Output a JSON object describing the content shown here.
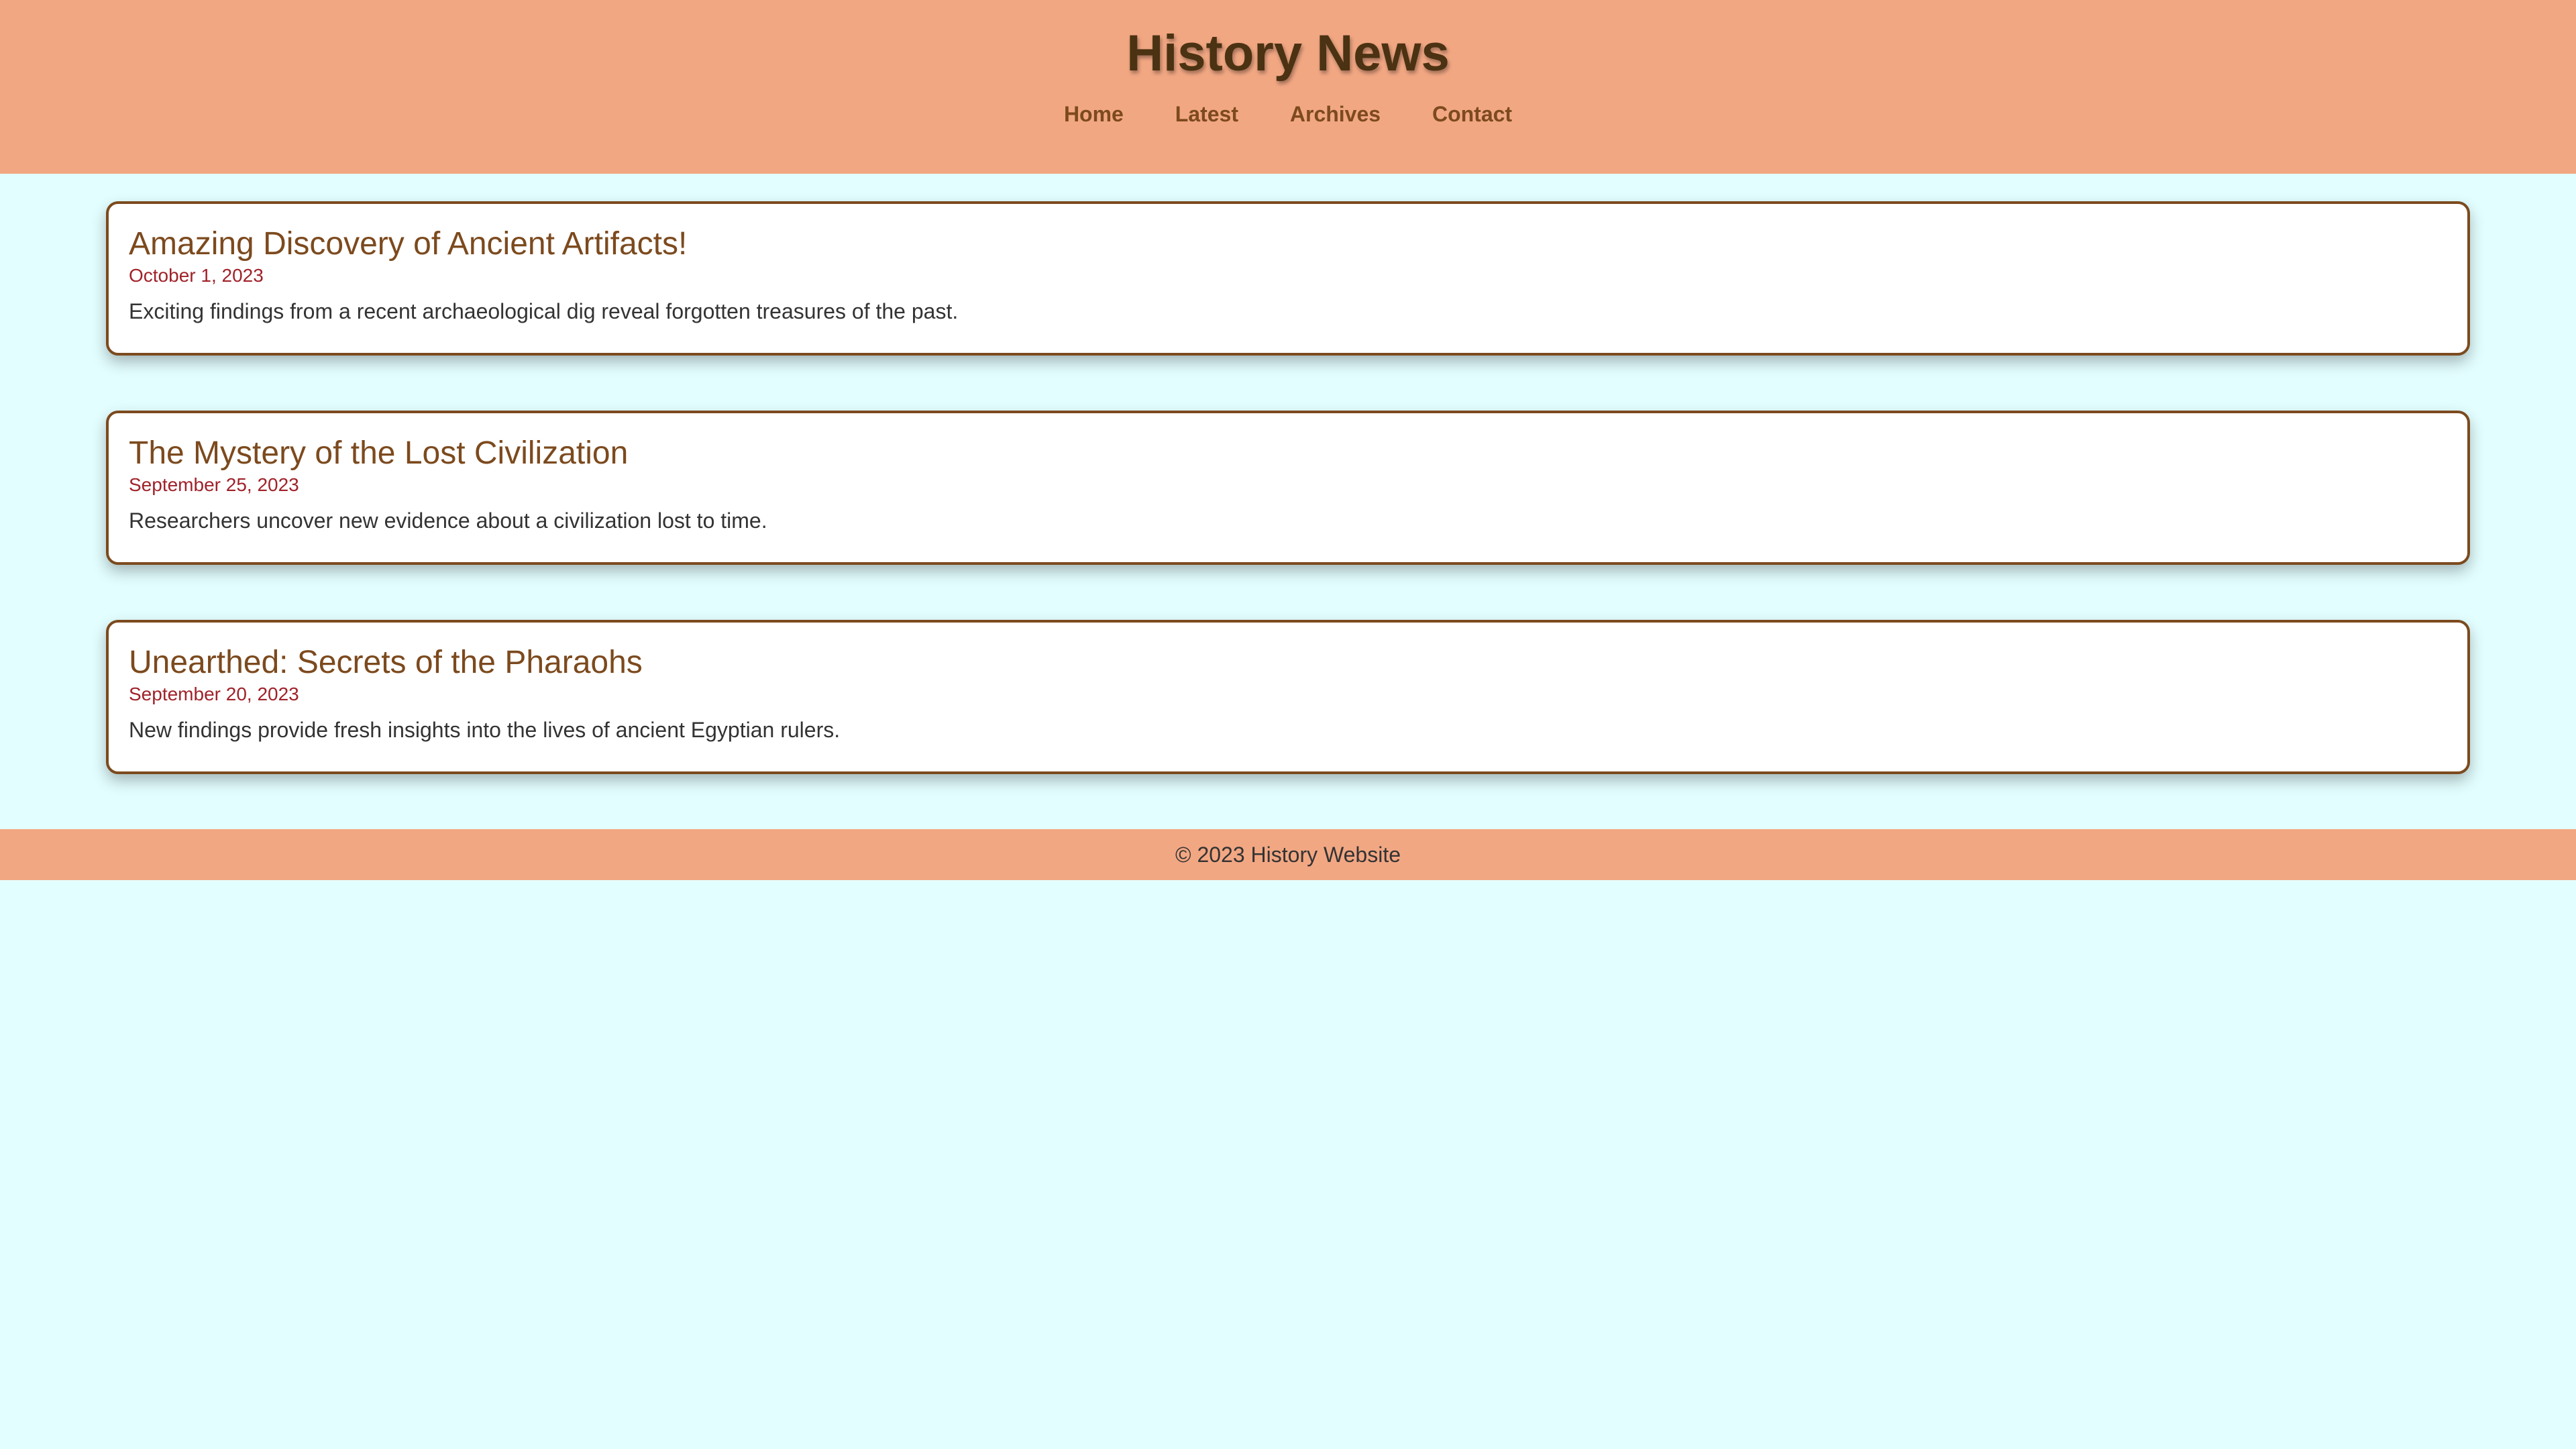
{
  "header": {
    "title": "History News",
    "nav": [
      "Home",
      "Latest",
      "Archives",
      "Contact"
    ]
  },
  "articles": [
    {
      "title": "Amazing Discovery of Ancient Artifacts!",
      "date": "October 1, 2023",
      "summary": "Exciting findings from a recent archaeological dig reveal forgotten treasures of the past."
    },
    {
      "title": "The Mystery of the Lost Civilization",
      "date": "September 25, 2023",
      "summary": "Researchers uncover new evidence about a civilization lost to time."
    },
    {
      "title": "Unearthed: Secrets of the Pharaohs",
      "date": "September 20, 2023",
      "summary": "New findings provide fresh insights into the lives of ancient Egyptian rulers."
    }
  ],
  "footer": {
    "text": "© 2023 History Website"
  },
  "colors": {
    "header_bg": "#f2a783",
    "page_bg": "#e3feff",
    "accent": "#7c4a1e",
    "date": "#a0222a",
    "title": "#4a3212"
  }
}
